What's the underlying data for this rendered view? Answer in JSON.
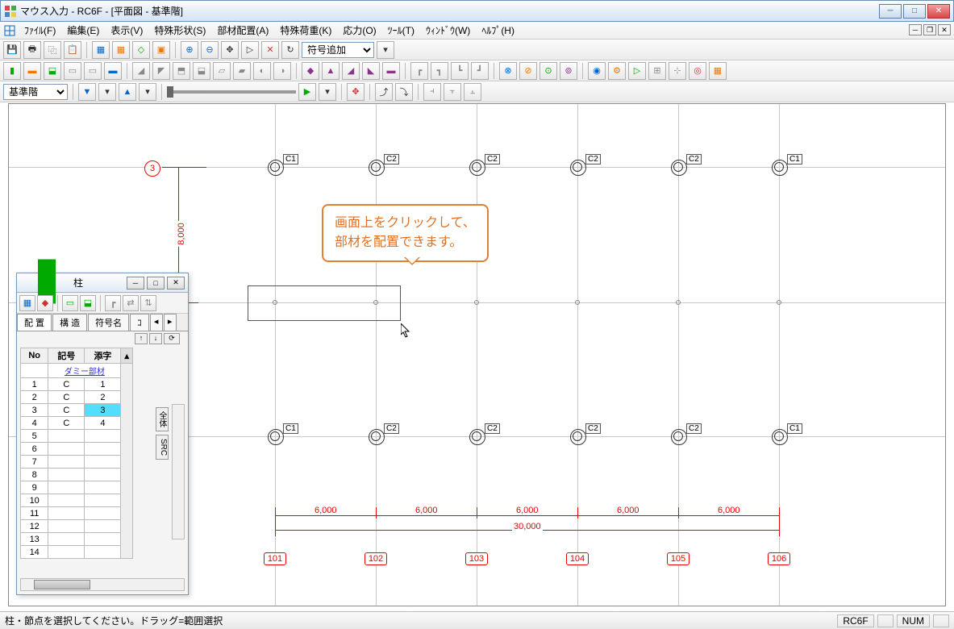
{
  "window": {
    "title": "マウス入力 - RC6F - [平面図 - 基準階]"
  },
  "menu": {
    "items": [
      "ﾌｧｲﾙ(F)",
      "編集(E)",
      "表示(V)",
      "特殊形状(S)",
      "部材配置(A)",
      "特殊荷重(K)",
      "応力(O)",
      "ﾂｰﾙ(T)",
      "ｳｨﾝﾄﾞｳ(W)",
      "ﾍﾙﾌﾟ(H)"
    ]
  },
  "toolbar1": {
    "combo": "符号追加"
  },
  "toolbar3": {
    "floor_combo": "基準階"
  },
  "callout": {
    "line1": "画面上をクリックして、",
    "line2": "部材を配置できます。"
  },
  "toolwindow": {
    "title": "柱",
    "tabs": [
      "配 置",
      "構 造",
      "符号名",
      "ｺ"
    ],
    "headers": [
      "No",
      "記号",
      "添字"
    ],
    "dummy_row": "ダミー部材",
    "rows": [
      {
        "no": "1",
        "mark": "C",
        "suf": "1"
      },
      {
        "no": "2",
        "mark": "C",
        "suf": "2"
      },
      {
        "no": "3",
        "mark": "C",
        "suf": "3",
        "selected": true
      },
      {
        "no": "4",
        "mark": "C",
        "suf": "4"
      },
      {
        "no": "5",
        "mark": "",
        "suf": ""
      },
      {
        "no": "6",
        "mark": "",
        "suf": ""
      },
      {
        "no": "7",
        "mark": "",
        "suf": ""
      },
      {
        "no": "8",
        "mark": "",
        "suf": ""
      },
      {
        "no": "9",
        "mark": "",
        "suf": ""
      },
      {
        "no": "10",
        "mark": "",
        "suf": ""
      },
      {
        "no": "11",
        "mark": "",
        "suf": ""
      },
      {
        "no": "12",
        "mark": "",
        "suf": ""
      },
      {
        "no": "13",
        "mark": "",
        "suf": ""
      },
      {
        "no": "14",
        "mark": "",
        "suf": ""
      }
    ],
    "vtabs": [
      "全体",
      "SRC"
    ]
  },
  "plan": {
    "row_axis_label": "3",
    "vdim": "8,000",
    "col_axes": [
      "101",
      "102",
      "103",
      "104",
      "105",
      "106"
    ],
    "hdims": [
      "6,000",
      "6,000",
      "6,000",
      "6,000",
      "6,000"
    ],
    "total_dim": "30,000",
    "col_labels_top": [
      "C1",
      "C2",
      "C2",
      "C2",
      "C2",
      "C1"
    ],
    "col_labels_bot": [
      "C1",
      "C2",
      "C2",
      "C2",
      "C2",
      "C1"
    ]
  },
  "status": {
    "message": "柱・節点を選択してください。ドラッグ=範囲選択",
    "model": "RC6F",
    "num": "NUM"
  }
}
